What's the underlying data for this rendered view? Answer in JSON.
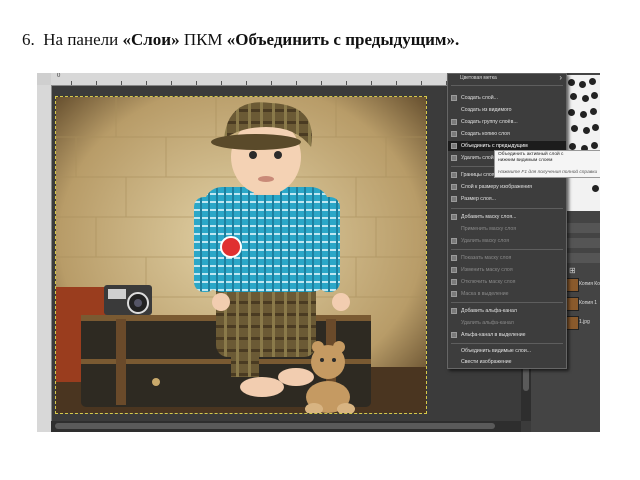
{
  "instruction": {
    "number": "6.",
    "text_before": "На панели",
    "panel": "«Слои»",
    "text_middle": "ПКМ",
    "command": "«Объединить с предыдущим»."
  },
  "menu": {
    "title": "Цветовая метка",
    "items": [
      {
        "label": "Создать слой...",
        "state": "normal"
      },
      {
        "label": "Создать из видимого",
        "state": "normal"
      },
      {
        "label": "Создать группу слоёв...",
        "state": "normal"
      },
      {
        "label": "Создать копию слоя",
        "state": "normal"
      },
      {
        "label": "Объединить с предыдущим",
        "state": "highlight"
      },
      {
        "label": "Удалить слой",
        "state": "normal"
      },
      {
        "label": "Границы слоя...",
        "state": "normal"
      },
      {
        "label": "Слой к размеру изображения",
        "state": "normal"
      },
      {
        "label": "Размер слоя...",
        "state": "normal"
      },
      {
        "label": "Добавить маску слоя...",
        "state": "normal"
      },
      {
        "label": "Применить маску слоя",
        "state": "disabled"
      },
      {
        "label": "Удалить маску слоя",
        "state": "disabled"
      },
      {
        "label": "Показать маску слоя",
        "state": "disabled"
      },
      {
        "label": "Изменить маску слоя",
        "state": "disabled"
      },
      {
        "label": "Отключить маску слоя",
        "state": "disabled"
      },
      {
        "label": "Маска в выделение",
        "state": "disabled"
      },
      {
        "label": "Добавить альфа-канал",
        "state": "normal"
      },
      {
        "label": "Удалить альфа-канал",
        "state": "disabled"
      },
      {
        "label": "Альфа-канал в выделение",
        "state": "normal"
      },
      {
        "label": "Объединить видимые слои...",
        "state": "normal"
      },
      {
        "label": "Свести изображение",
        "state": "normal"
      }
    ]
  },
  "tooltip": {
    "line1": "Объединить активный слой с",
    "line2": "нижним видимым слоем",
    "hint": "Нажмите F1 для получения полной справки"
  },
  "layers": [
    {
      "name": "Копия Ко"
    },
    {
      "name": "Копия 1"
    },
    {
      "name": "1.jpg"
    }
  ],
  "colors": {
    "menu_bg": "#3d3d3d",
    "menu_highlight": "#1c1c1c",
    "app_bg": "#3b3b3b",
    "shirt": "#2aa7c8",
    "cap_pants": "#6b5a35",
    "wall": "#d8c49a"
  }
}
